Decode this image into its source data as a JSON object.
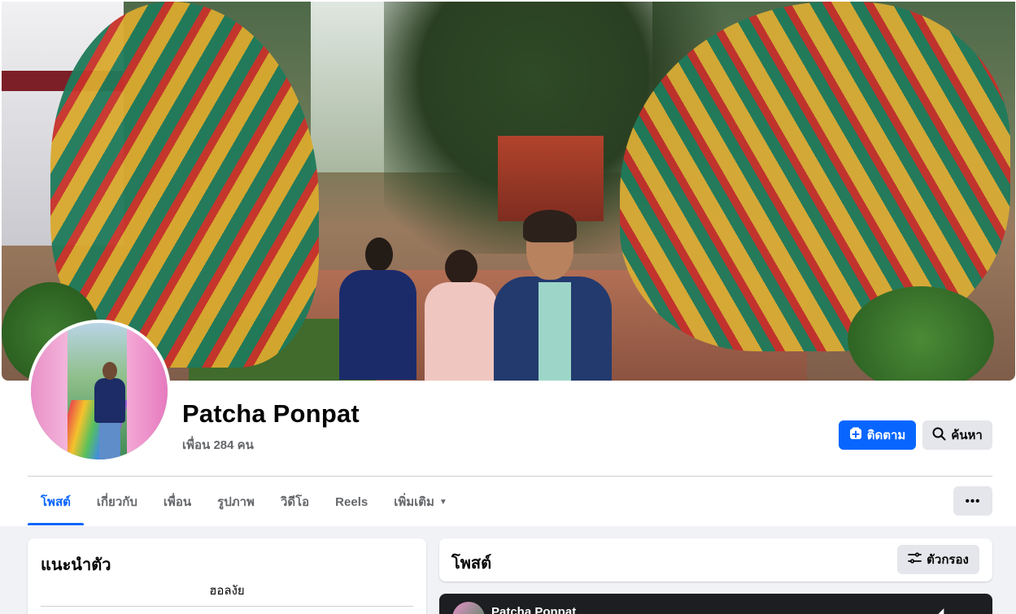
{
  "profile": {
    "name": "Patcha Ponpat",
    "friends_text": "เพื่อน 284 คน"
  },
  "actions": {
    "follow_label": "ติดตาม",
    "search_label": "ค้นหา",
    "more_label": "•••"
  },
  "tabs": [
    {
      "label": "โพสต์",
      "active": true
    },
    {
      "label": "เกี่ยวกับ"
    },
    {
      "label": "เพื่อน"
    },
    {
      "label": "รูปภาพ"
    },
    {
      "label": "วิดีโอ"
    },
    {
      "label": "Reels"
    },
    {
      "label": "เพิ่มเติม",
      "has_dropdown": true
    }
  ],
  "intro": {
    "title": "แนะนำตัว",
    "bio": "ฮอลงัย"
  },
  "posts": {
    "title": "โพสต์",
    "filter_label": "ตัวกรอง",
    "first_post_author": "Patcha Ponpat"
  },
  "icons": {
    "follow": "follow-plus-icon",
    "search": "search-icon",
    "filter": "filter-sliders-icon",
    "dropdown": "caret-down-icon",
    "more": "more-dots-icon"
  },
  "colors": {
    "accent": "#0866ff",
    "secondary_button": "#e4e6eb",
    "page_background": "#f0f2f5",
    "muted_text": "#65676b"
  }
}
